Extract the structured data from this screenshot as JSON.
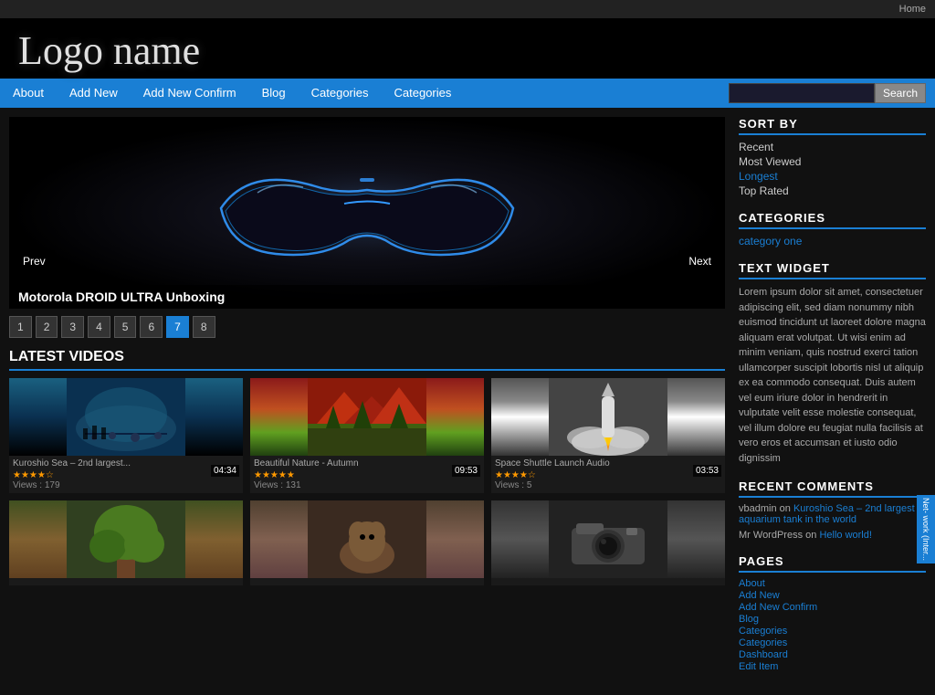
{
  "topbar": {
    "home_link": "Home"
  },
  "logo": {
    "text": "Logo name"
  },
  "nav": {
    "items": [
      {
        "label": "About",
        "id": "about"
      },
      {
        "label": "Add New",
        "id": "add-new"
      },
      {
        "label": "Add New Confirm",
        "id": "add-new-confirm"
      },
      {
        "label": "Blog",
        "id": "blog"
      },
      {
        "label": "Categories",
        "id": "categories-1"
      },
      {
        "label": "Categories",
        "id": "categories-2"
      }
    ],
    "search_placeholder": "",
    "search_button": "Search"
  },
  "slider": {
    "caption": "Motorola DROID ULTRA Unboxing",
    "prev_label": "Prev",
    "next_label": "Next",
    "pages": [
      "1",
      "2",
      "3",
      "4",
      "5",
      "6",
      "7",
      "8"
    ],
    "active_page": 6
  },
  "latest_videos": {
    "title": "LATEST VIDEOS",
    "videos": [
      {
        "title": "Kuroshio Sea – 2nd largest...",
        "duration": "04:34",
        "stars": 4,
        "views": "179"
      },
      {
        "title": "Beautiful Nature - Autumn",
        "duration": "09:53",
        "stars": 5,
        "views": "131"
      },
      {
        "title": "Space Shuttle Launch Audio",
        "duration": "03:53",
        "stars": 4,
        "views": "5"
      },
      {
        "title": "",
        "duration": "",
        "stars": 0,
        "views": ""
      },
      {
        "title": "",
        "duration": "",
        "stars": 0,
        "views": ""
      },
      {
        "title": "",
        "duration": "",
        "stars": 0,
        "views": ""
      }
    ]
  },
  "sidebar": {
    "sort_by": {
      "title": "SORT BY",
      "items": [
        {
          "label": "Recent",
          "style": "recent"
        },
        {
          "label": "Most Viewed",
          "style": "recent"
        },
        {
          "label": "Longest",
          "style": "longest"
        },
        {
          "label": "Top Rated",
          "style": "top-rated"
        }
      ]
    },
    "categories": {
      "title": "CATEGORIES",
      "items": [
        {
          "label": "category one"
        }
      ]
    },
    "text_widget": {
      "title": "TEXT WIDGET",
      "body": "Lorem ipsum dolor sit amet, consectetuer adipiscing elit, sed diam nonummy nibh euismod tincidunt ut laoreet dolore magna aliquam erat volutpat. Ut wisi enim ad minim veniam, quis nostrud exerci tation ullamcorper suscipit lobortis nisl ut aliquip ex ea commodo consequat. Duis autem vel eum iriure dolor in hendrerit in vulputate velit esse molestie consequat, vel illum dolore eu feugiat nulla facilisis at vero eros et accumsan et iusto odio dignissim"
    },
    "recent_comments": {
      "title": "RECENT COMMENTS",
      "comments": [
        {
          "author": "vbadmin",
          "link_text": "Kuroshio Sea – 2nd largest aquarium tank in the world",
          "on": "on"
        },
        {
          "author": "Mr WordPress",
          "link_text": "Hello world!",
          "on": "on"
        }
      ]
    },
    "pages": {
      "title": "PAGES",
      "items": [
        "About",
        "Add New",
        "Add New Confirm",
        "Blog",
        "Categories",
        "Categories",
        "Dashboard",
        "Edit Item"
      ]
    }
  },
  "network": {
    "label": "Net- work (Inter..."
  }
}
